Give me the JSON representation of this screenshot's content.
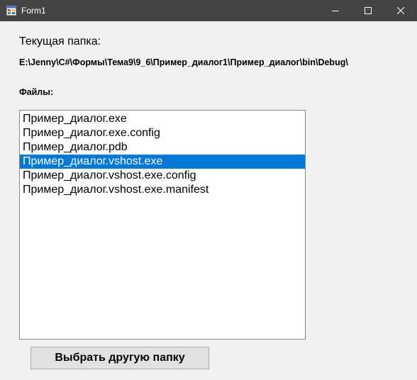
{
  "window": {
    "title": "Form1",
    "controls": {
      "minimize": "minimize-icon",
      "maximize": "maximize-icon",
      "close": "close-icon"
    }
  },
  "labels": {
    "current_folder": "Текущая папка:",
    "path": "E:\\Jenny\\C#\\Формы\\Тема9\\9_6\\Пример_диалог1\\Пример_диалог\\bin\\Debug\\",
    "files": "Файлы:"
  },
  "files": {
    "items": [
      "Пример_диалог.exe",
      "Пример_диалог.exe.config",
      "Пример_диалог.pdb",
      "Пример_диалог.vshost.exe",
      "Пример_диалог.vshost.exe.config",
      "Пример_диалог.vshost.exe.manifest"
    ],
    "selected_index": 3
  },
  "buttons": {
    "choose_folder": "Выбрать другую папку"
  },
  "colors": {
    "titlebar": "#444444",
    "selection": "#0078d7",
    "background": "#f0f0f0"
  }
}
